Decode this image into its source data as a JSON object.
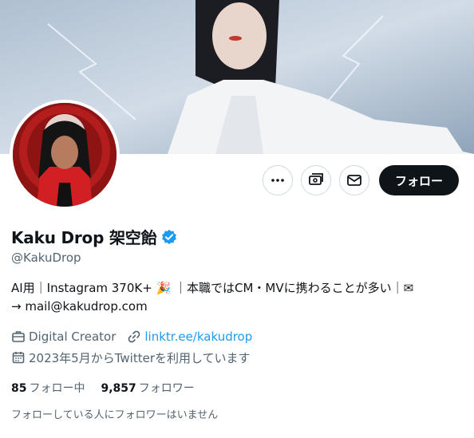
{
  "profile": {
    "display_name": "Kaku Drop 架空飴",
    "handle": "@KakuDrop",
    "bio_line1": "AI用｜Instagram 370K+ 🎉 ｜本職ではCM・MVに携わることが多い｜✉",
    "bio_line2": "→ mail@kakudrop.com",
    "category": "Digital Creator",
    "link": "linktr.ee/kakudrop",
    "joined": "2023年5月からTwitterを利用しています"
  },
  "actions": {
    "follow_label": "フォロー",
    "more_icon": "more-dots-icon",
    "subscribe_icon": "money-icon",
    "message_icon": "envelope-icon"
  },
  "stats": {
    "following_count": "85",
    "following_label": "フォロー中",
    "followers_count": "9,857",
    "followers_label": "フォロワー"
  },
  "mutual_text": "フォローしている人にフォロワーはいません",
  "colors": {
    "accent": "#1d9bf0",
    "follow_bg": "#0f1419",
    "secondary_text": "#536471",
    "border": "#cfd9de"
  }
}
